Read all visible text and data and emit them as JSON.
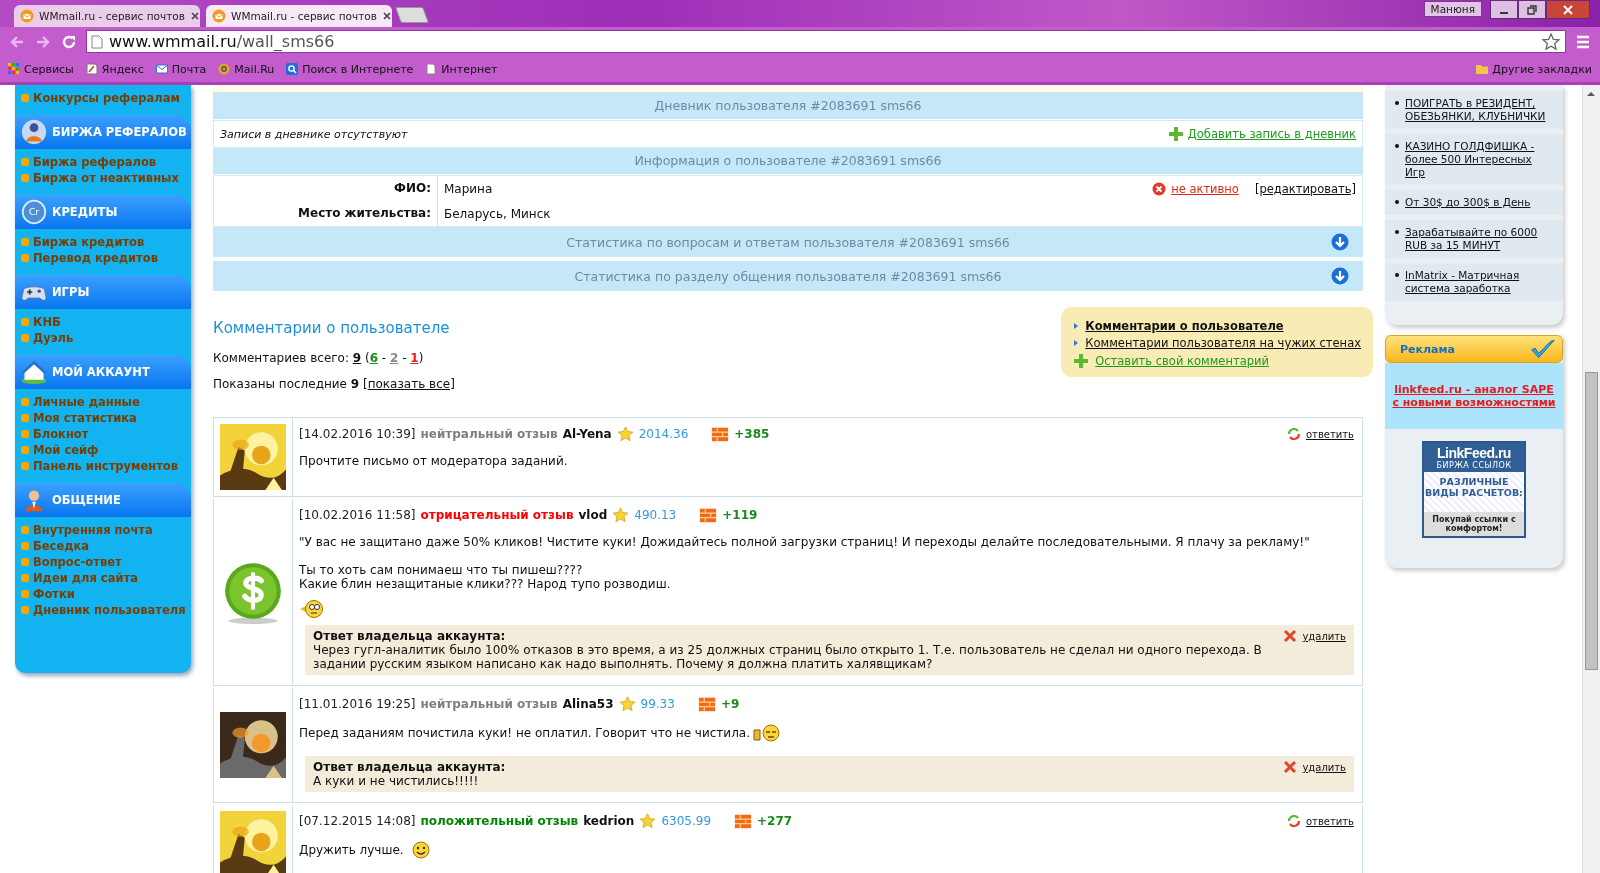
{
  "browser": {
    "tabs": [
      {
        "title": "WMmail.ru - сервис почтов",
        "selected": false
      },
      {
        "title": "WMmail.ru - сервис почтов",
        "selected": true
      }
    ],
    "profile": "Манюня",
    "address": {
      "host": "www.wmmail.ru",
      "path": "/wall_sms66"
    },
    "bookmarks": [
      {
        "label": "Сервисы",
        "kind": "apps"
      },
      {
        "label": "Яндекс",
        "kind": "doc"
      },
      {
        "label": "Почта",
        "kind": "mail"
      },
      {
        "label": "Mail.Ru",
        "kind": "at"
      },
      {
        "label": "Поиск в Интернете",
        "kind": "search"
      },
      {
        "label": "Интернет",
        "kind": "page"
      }
    ],
    "other_bookmarks": "Другие закладки"
  },
  "sidebar": {
    "top_items": [
      "Конкурсы рефералам"
    ],
    "sections": [
      {
        "title": "БИРЖА РЕФЕРАЛОВ",
        "items": [
          "Биржа рефералов",
          "Биржа от неактивных"
        ]
      },
      {
        "title": "КРЕДИТЫ",
        "icon_text": "Cr",
        "items": [
          "Биржа кредитов",
          "Перевод кредитов"
        ]
      },
      {
        "title": "ИГРЫ",
        "items": [
          "КНБ",
          "Дуэль"
        ]
      },
      {
        "title": "МОЙ АККАУНТ",
        "items": [
          "Личные данные",
          "Моя статистика",
          "Блокнот",
          "Мой сейф",
          "Панель инструментов"
        ]
      },
      {
        "title": "ОБЩЕНИЕ",
        "items": [
          "Внутренняя почта",
          "Беседка",
          "Вопрос-ответ",
          "Идеи для сайта",
          "Фотки",
          "Дневник пользователя"
        ]
      }
    ]
  },
  "diary": {
    "title": "Дневник пользователя #2083691 sms66",
    "empty_text": "Записи в дневнике отсутствуют",
    "add_link": "Добавить запись в дневник"
  },
  "info": {
    "title": "Информация о пользователе #2083691 sms66",
    "rows": [
      {
        "label": "ФИО:",
        "value": "Марина"
      },
      {
        "label": "Место жительства:",
        "value": "Беларусь, Минск"
      }
    ],
    "status": "не активно",
    "edit": "[редактировать]"
  },
  "stats_panels": [
    "Статистика по вопросам и ответам пользователя #2083691 sms66",
    "Статистика по разделу общения пользователя #2083691 sms66"
  ],
  "comments_section": {
    "title": "Комментарии о пользователе",
    "count_line": [
      {
        "text": "Комментариев всего: ",
        "kind": "plain"
      },
      {
        "text": "9",
        "kind": "total"
      },
      {
        "text": " (",
        "kind": "plain"
      },
      {
        "text": "6",
        "kind": "positive"
      },
      {
        "text": " - ",
        "kind": "plain"
      },
      {
        "text": "2",
        "kind": "neutral"
      },
      {
        "text": " - ",
        "kind": "plain"
      },
      {
        "text": "1",
        "kind": "negative"
      },
      {
        "text": ")",
        "kind": "plain"
      }
    ],
    "shown_line": [
      {
        "text": "Показаны последние ",
        "kind": "plain"
      },
      {
        "text": "9",
        "kind": "bold"
      },
      {
        "text": " [",
        "kind": "plain"
      },
      {
        "text": "показать все",
        "kind": "link"
      },
      {
        "text": "]",
        "kind": "plain"
      }
    ],
    "menu": [
      {
        "label": "Комментарии о пользователе",
        "kind": "arrow",
        "selected": true
      },
      {
        "label": "Комментарии пользователя на чужих стенах",
        "kind": "arrow",
        "selected": false
      },
      {
        "label": "Оставить свой комментарий",
        "kind": "add",
        "selected": false
      }
    ]
  },
  "comments": [
    {
      "kind": "picture",
      "date": "[14.02.2016 10:39]",
      "color": "#7f7f7f",
      "rating_text": "нейтральный отзыв",
      "author": "Al-Yena",
      "score": "2014.36",
      "bonus": "+385",
      "paragraphs": [
        [
          "Прочтите письмо от модератора заданий."
        ]
      ],
      "action": {
        "label": "ответить",
        "kind": "reply"
      }
    },
    {
      "kind": "dollar",
      "date": "[10.02.2016 11:58]",
      "color": "#ff0000",
      "rating_text": "отрицательный отзыв",
      "author": "vlod",
      "score": "490.13",
      "bonus": "+119",
      "paragraphs": [
        [
          "\"У вас не защитано даже 50% кликов! Чистите куки! Дожидайтесь полной загрузки страниц! И переходы делайте последовательными. Я плачу за рекламу!\""
        ],
        [
          "Ты то хоть сам понимаеш что ты пишеш????",
          "Какие блин незащитаные клики??? Народ тупо розводиш."
        ]
      ],
      "emoticon": {
        "kind": "thinking"
      },
      "reply": {
        "title": "Ответ владельца аккаунта:",
        "text": "Через гугл-аналитик было 100% отказов в это время, а из 25 должных страниц было открыто 1. Т.е. пользователь не сделал ни одного перехода. В задании русским языком написано как надо выполнять. Почему я должна платить халявщикам?",
        "action": "удалить"
      }
    },
    {
      "kind": "picture",
      "date": "[11.01.2016 19:25]",
      "color": "#7f7f7f",
      "rating_text": "нейтральный отзыв",
      "author": "Alina53",
      "score": "99.33",
      "bonus": "+9",
      "paragraphs": [
        [
          "Перед заданиям почистила куки! не оплатил. Говорит что не чистила."
        ]
      ],
      "emoticon": {
        "kind": "thumb"
      },
      "reply": {
        "title": "Ответ владельца аккаунта:",
        "text": "А куки и не чистились!!!!!",
        "action": "удалить"
      }
    },
    {
      "kind": "picture",
      "date": "[07.12.2015 14:08]",
      "color": "#008800",
      "rating_text": "положительный отзыв",
      "author": "kedrion",
      "score": "6305.99",
      "bonus": "+277",
      "paragraphs": [
        [
          "Дружить лучше."
        ]
      ],
      "emoticon": {
        "kind": "smile"
      },
      "action": {
        "label": "ответить",
        "kind": "reply"
      }
    }
  ],
  "right": {
    "ads": [
      "ПОИГРАТЬ в РЕЗИДЕНТ, ОБЕЗЬЯНКИ, КЛУБНИЧКИ",
      "КАЗИНО ГОЛДФИШКА - более 500 Интересных Игр",
      "От 30$ до 300$ в День",
      "Зарабатывайте по 6000 RUB за 15 МИНУТ",
      "InMatrix - Матричная система заработка"
    ],
    "promo_title": "Реклама",
    "promo_link": "linkfeed.ru - аналог SAPE с новыми возможностями",
    "banner": {
      "logo": "LinkFeed.ru",
      "subtitle": "БИРЖА ССЫЛОК",
      "headline": "РАЗЛИЧНЫЕ ВИДЫ РАСЧЕТОВ:",
      "footer": "Покупай ссылки с комфортом!"
    }
  }
}
